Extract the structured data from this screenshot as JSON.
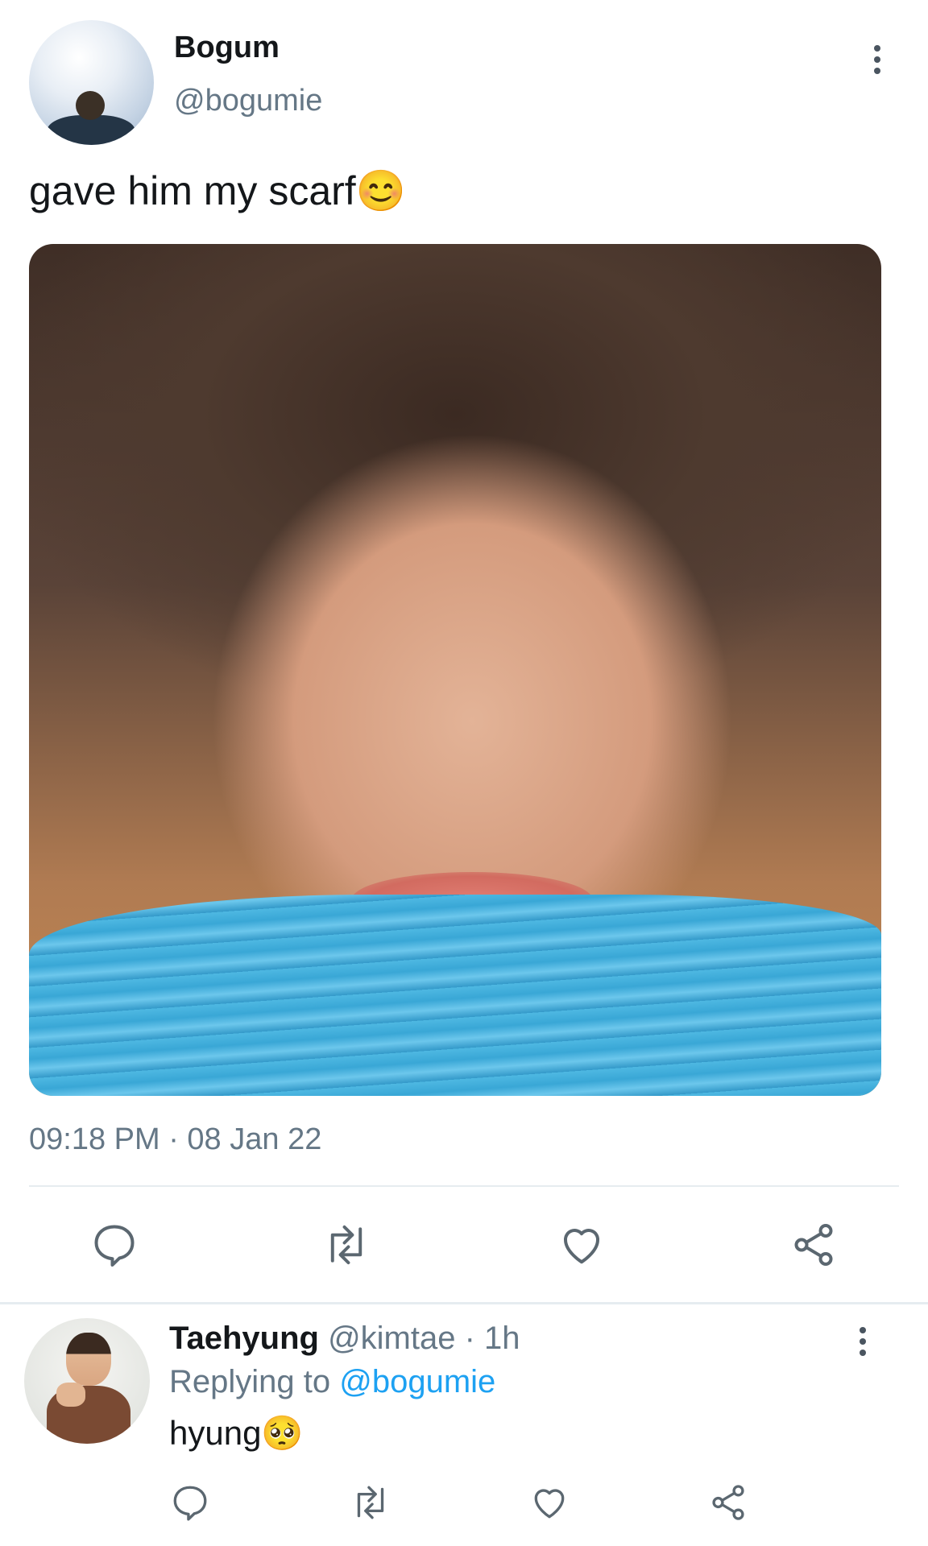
{
  "tweet": {
    "author_name": "Bogum",
    "handle": "@bogumie",
    "text": "gave him my scarf😊",
    "timestamp": "09:18 PM · 08 Jan 22",
    "image_alt": "photo of smiling face wrapped in a blue scarf"
  },
  "actions": {
    "icons": [
      "reply-icon",
      "retweet-icon",
      "like-icon",
      "share-icon"
    ]
  },
  "reply": {
    "author_name": "Taehyung",
    "handle_time": "@kimtae · 1h",
    "replying_prefix": "Replying to",
    "replying_to": "@bogumie",
    "text": "hyung🥺"
  },
  "colors": {
    "link": "#1da1f2",
    "muted": "#657786",
    "icon": "#5b6770",
    "divider": "#e6ecf0"
  }
}
